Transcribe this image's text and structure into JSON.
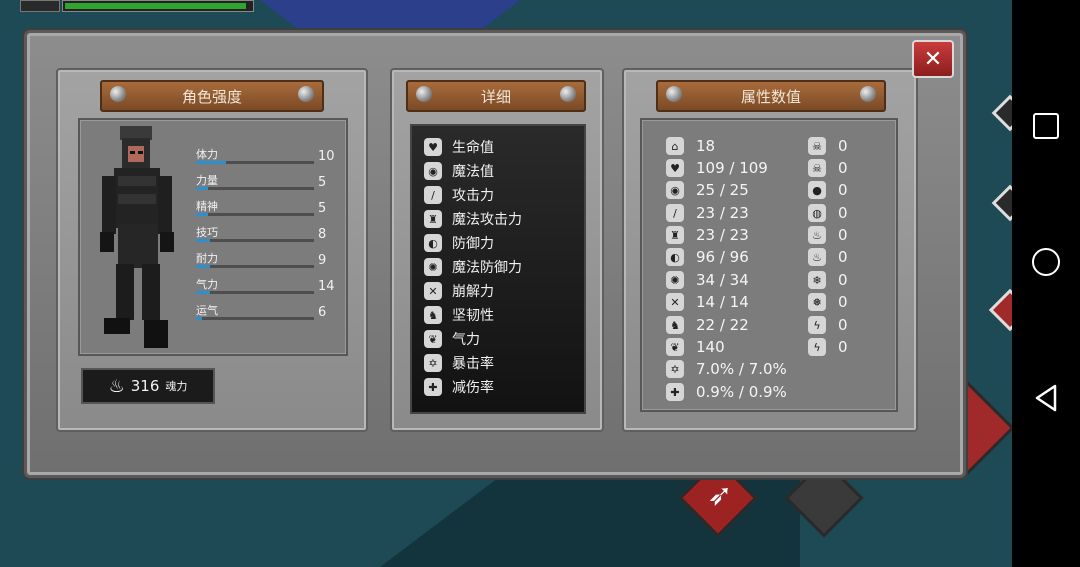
{
  "character_panel": {
    "title": "角色强度",
    "stats": [
      {
        "label": "体力",
        "value": "10",
        "fill": 0.25
      },
      {
        "label": "力量",
        "value": "5",
        "fill": 0.1
      },
      {
        "label": "精神",
        "value": "5",
        "fill": 0.1
      },
      {
        "label": "技巧",
        "value": "8",
        "fill": 0.12
      },
      {
        "label": "耐力",
        "value": "9",
        "fill": 0.12
      },
      {
        "label": "气力",
        "value": "14",
        "fill": 0.12
      },
      {
        "label": "运气",
        "value": "6",
        "fill": 0.05
      }
    ],
    "souls": {
      "value": "316",
      "unit": "魂力"
    }
  },
  "detail_panel": {
    "title": "详细",
    "items": [
      {
        "label": "生命值",
        "icon": "heart-icon",
        "glyph": "♥"
      },
      {
        "label": "魔法值",
        "icon": "brain-icon",
        "glyph": "◉"
      },
      {
        "label": "攻击力",
        "icon": "sword-icon",
        "glyph": "/"
      },
      {
        "label": "魔法攻击力",
        "icon": "castle-icon",
        "glyph": "♜"
      },
      {
        "label": "防御力",
        "icon": "shield-icon",
        "glyph": "◐"
      },
      {
        "label": "魔法防御力",
        "icon": "magic-shield-icon",
        "glyph": "✺"
      },
      {
        "label": "崩解力",
        "icon": "crossed-swords-icon",
        "glyph": "✕"
      },
      {
        "label": "坚韧性",
        "icon": "helmet-icon",
        "glyph": "♞"
      },
      {
        "label": "气力",
        "icon": "lungs-icon",
        "glyph": "❦"
      },
      {
        "label": "暴击率",
        "icon": "star-icon",
        "glyph": "✡"
      },
      {
        "label": "减伤率",
        "icon": "badge-icon",
        "glyph": "✚"
      }
    ]
  },
  "attribute_panel": {
    "title": "属性数值",
    "left_values": [
      {
        "icon": "level-icon",
        "glyph": "⌂",
        "value": "18"
      },
      {
        "icon": "heart-icon",
        "glyph": "♥",
        "value": "109 / 109"
      },
      {
        "icon": "brain-icon",
        "glyph": "◉",
        "value": "25 / 25"
      },
      {
        "icon": "sword-icon",
        "glyph": "/",
        "value": "23 / 23"
      },
      {
        "icon": "castle-icon",
        "glyph": "♜",
        "value": "23 / 23"
      },
      {
        "icon": "shield-icon",
        "glyph": "◐",
        "value": "96 / 96"
      },
      {
        "icon": "magic-shield-icon",
        "glyph": "✺",
        "value": "34 / 34"
      },
      {
        "icon": "crossed-swords-icon",
        "glyph": "✕",
        "value": "14 / 14"
      },
      {
        "icon": "helmet-icon",
        "glyph": "♞",
        "value": "22 / 22"
      },
      {
        "icon": "lungs-icon",
        "glyph": "❦",
        "value": "140"
      },
      {
        "icon": "star-icon",
        "glyph": "✡",
        "value": "7.0% / 7.0%"
      },
      {
        "icon": "badge-icon",
        "glyph": "✚",
        "value": "0.9% / 0.9%"
      }
    ],
    "right_values": [
      {
        "icon": "skull-icon",
        "glyph": "☠",
        "value": "0"
      },
      {
        "icon": "skull-bones-icon",
        "glyph": "☠",
        "value": "0"
      },
      {
        "icon": "drop-icon",
        "glyph": "●",
        "value": "0"
      },
      {
        "icon": "drop-slash-icon",
        "glyph": "◍",
        "value": "0"
      },
      {
        "icon": "fire-icon",
        "glyph": "♨",
        "value": "0"
      },
      {
        "icon": "fire-slash-icon",
        "glyph": "♨",
        "value": "0"
      },
      {
        "icon": "snowflake-icon",
        "glyph": "❄",
        "value": "0"
      },
      {
        "icon": "snowflake-slash-icon",
        "glyph": "❅",
        "value": "0"
      },
      {
        "icon": "lightning-icon",
        "glyph": "ϟ",
        "value": "0"
      },
      {
        "icon": "lightning-slash-icon",
        "glyph": "ϟ",
        "value": "0"
      }
    ]
  },
  "close_button": {
    "glyph": "✕"
  },
  "colors": {
    "accent_red": "#b52a2a",
    "bar_blue": "#2b8fd0",
    "hp_green": "#2fa52f"
  }
}
